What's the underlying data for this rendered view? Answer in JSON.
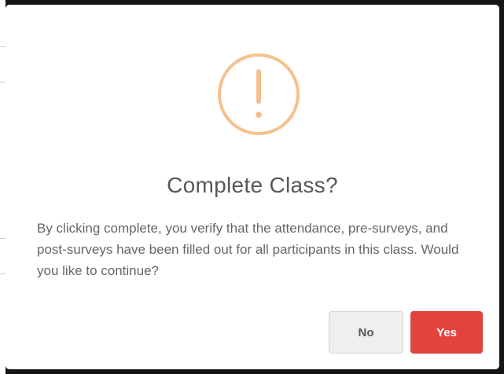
{
  "dialog": {
    "title": "Complete Class?",
    "message": "By clicking complete, you verify that the attendance, pre-surveys, and post-surveys have been filled out for all participants in this class. Would you like to continue?",
    "icon": "warning-icon",
    "buttons": {
      "no_label": "No",
      "yes_label": "Yes"
    }
  },
  "colors": {
    "icon_accent": "#f6c08e",
    "confirm_button": "#e3433f",
    "cancel_button": "#efefef",
    "title_text": "#575757",
    "body_text": "#666666"
  }
}
